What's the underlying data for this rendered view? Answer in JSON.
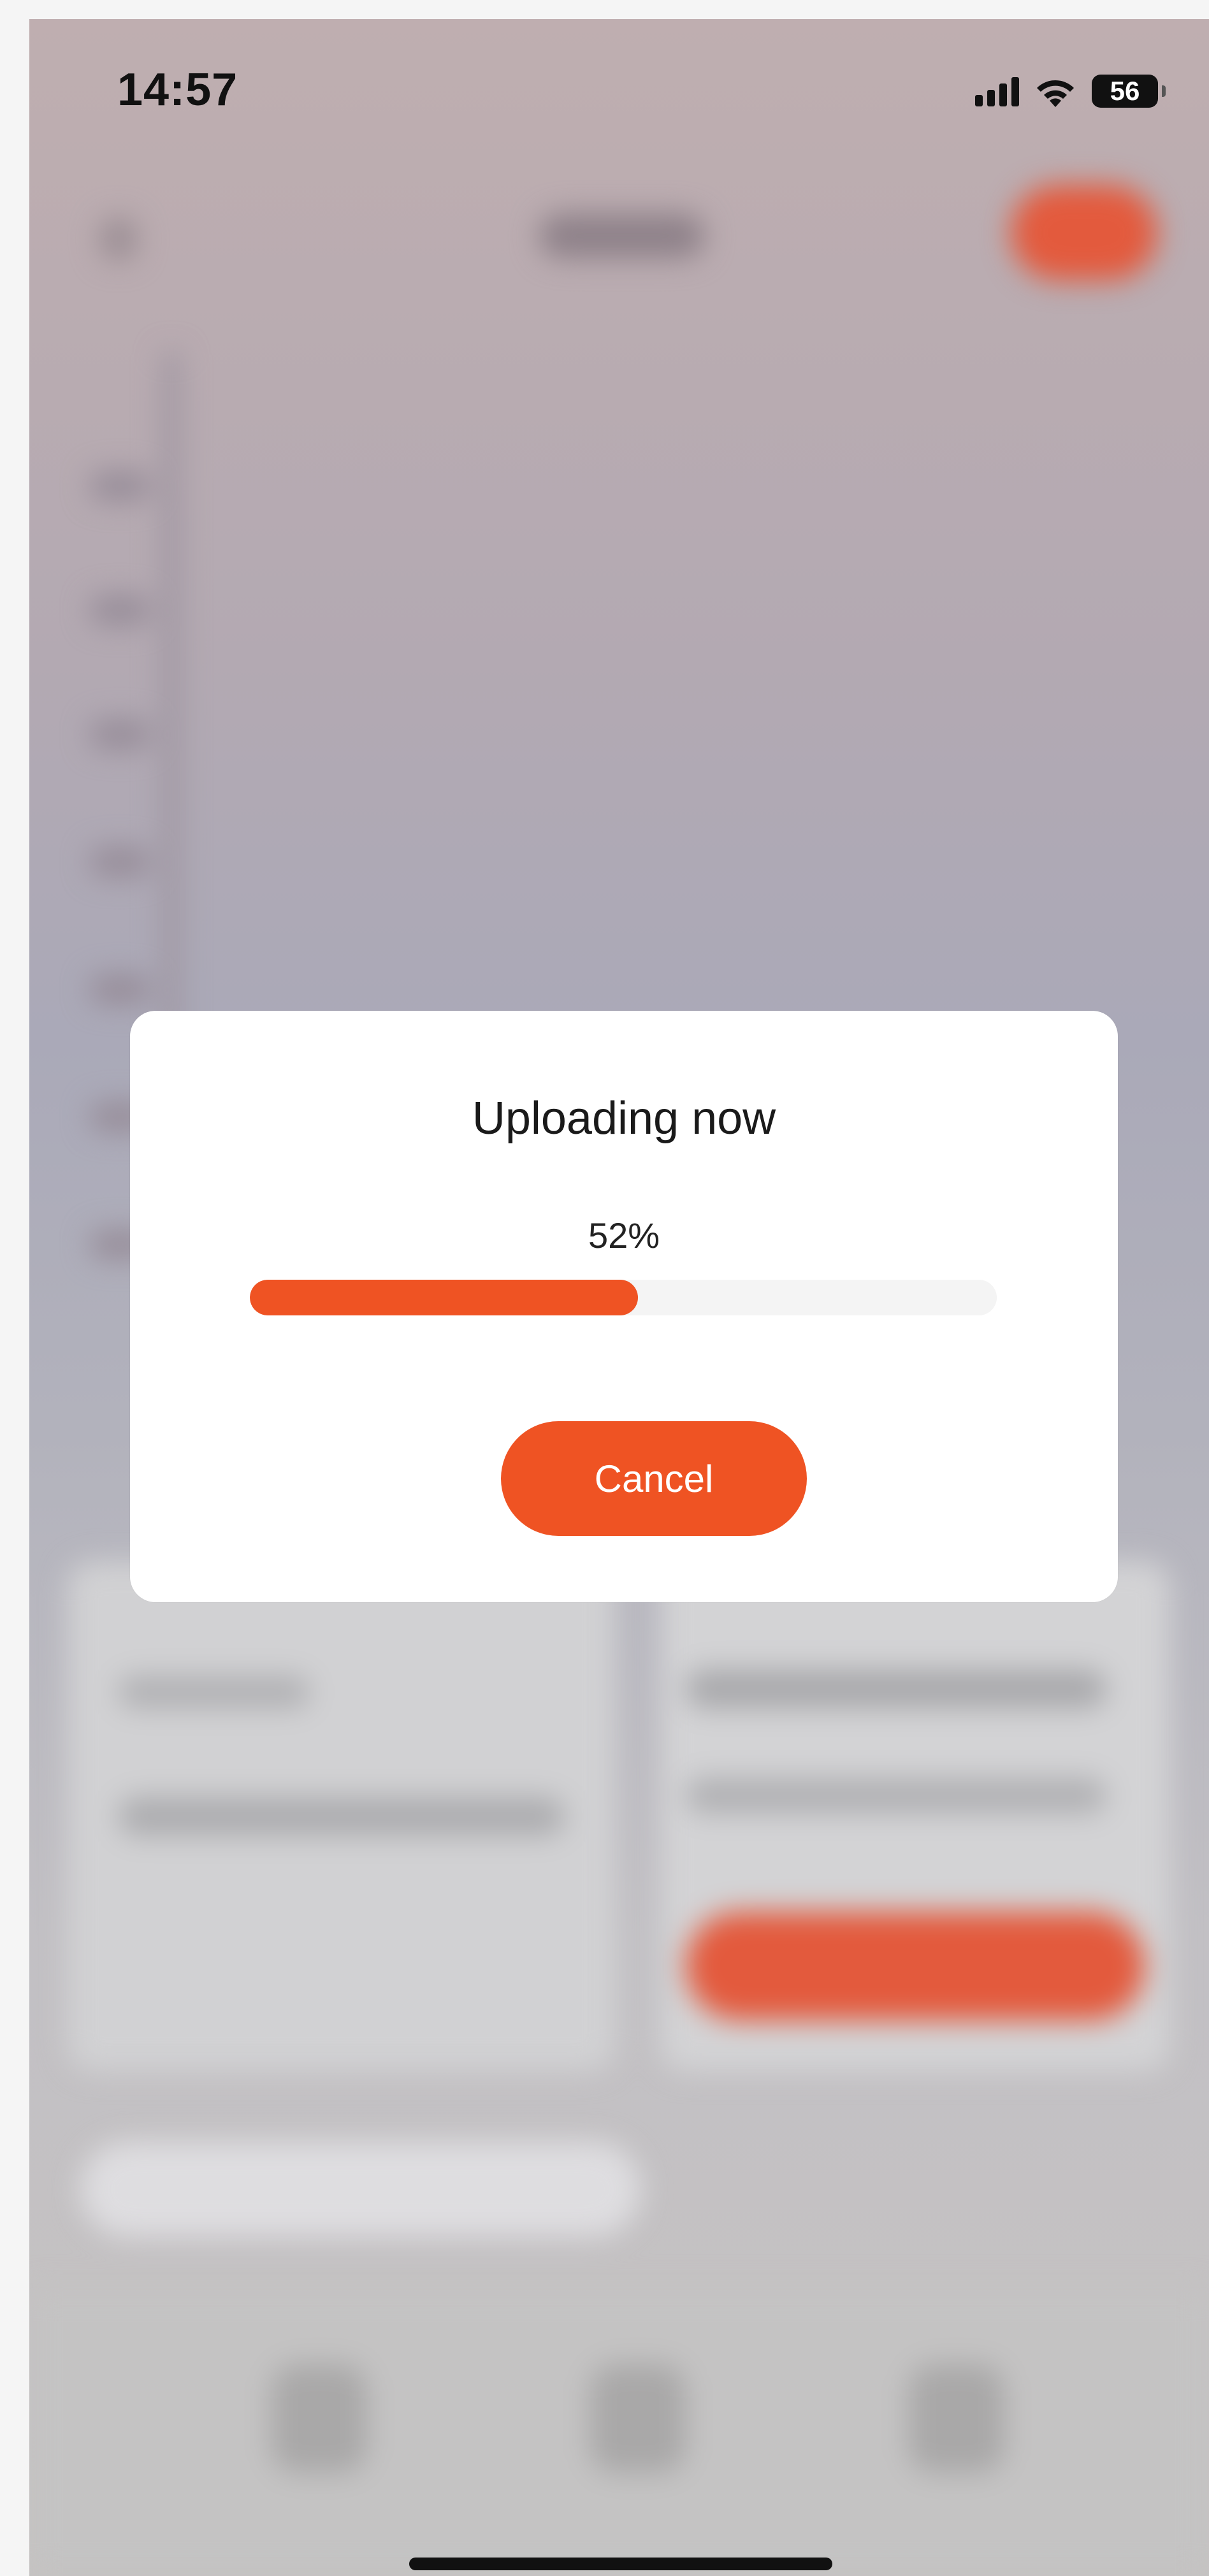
{
  "status_bar": {
    "time": "14:57",
    "battery": "56",
    "icons": [
      "signal-icon",
      "wifi-icon",
      "battery-icon"
    ]
  },
  "upload_dialog": {
    "title": "Uploading now",
    "progress_text": "52%",
    "progress_fraction": 0.52,
    "cancel_label": "Cancel"
  },
  "colors": {
    "accent": "#ef5323",
    "track": "#f4f4f4",
    "dialog_bg": "#ffffff"
  }
}
